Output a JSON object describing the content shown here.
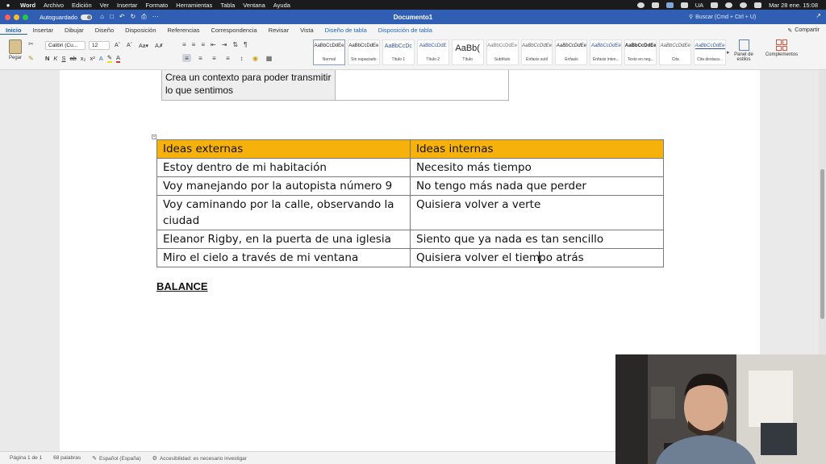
{
  "menubar": {
    "app": "Word",
    "items": [
      "Archivo",
      "Edición",
      "Ver",
      "Insertar",
      "Formato",
      "Herramientas",
      "Tabla",
      "Ventana",
      "Ayuda"
    ],
    "keyboard": "UA",
    "clock": "Mar 28 ene.  15:08"
  },
  "titlebar": {
    "autosave_label": "Autoguardado",
    "document_title": "Documento1",
    "search_placeholder": "Buscar (Cmd + Ctrl + U)"
  },
  "ribbon_tabs": [
    "Inicio",
    "Insertar",
    "Dibujar",
    "Diseño",
    "Disposición",
    "Referencias",
    "Correspondencia",
    "Revisar",
    "Vista",
    "Diseño de tabla",
    "Disposición de tabla"
  ],
  "share_label": "Compartir",
  "ribbon": {
    "paste_label": "Pegar",
    "font_name": "Calibri (Cu...",
    "font_size": "12",
    "styles": [
      {
        "preview": "AaBbCcDdEe",
        "name": "Normal"
      },
      {
        "preview": "AaBbCcDdEe",
        "name": "Sin espaciado"
      },
      {
        "preview": "AaBbCcDc",
        "name": "Título 1"
      },
      {
        "preview": "AaBbCcDdE",
        "name": "Título 2"
      },
      {
        "preview": "AaBb(",
        "name": "Título"
      },
      {
        "preview": "AaBbCcDdEe",
        "name": "Subtítulo"
      },
      {
        "preview": "AaBbCcDdEe",
        "name": "Énfasis sutil"
      },
      {
        "preview": "AaBbCcDdEe",
        "name": "Énfasis"
      },
      {
        "preview": "AaBbCcDdEe",
        "name": "Énfasis inten..."
      },
      {
        "preview": "AaBbCcDdEe",
        "name": "Texto en neg..."
      },
      {
        "preview": "AaBbCcDdEe",
        "name": "Cita"
      },
      {
        "preview": "AaBbCcDdEe",
        "name": "Cita destaca..."
      }
    ],
    "styles_pane_label": "Panel de estilos",
    "addins_label": "Complementos"
  },
  "document": {
    "previous_table_text": "Crea un contexto para poder transmitir lo que sentimos",
    "table": {
      "headers": [
        "Ideas externas",
        "Ideas internas"
      ],
      "rows": [
        [
          "Estoy dentro de mi habitación",
          "Necesito más tiempo"
        ],
        [
          "Voy manejando por la autopista número 9",
          "No tengo más nada que perder"
        ],
        [
          "Voy caminando por la calle, observando la ciudad",
          "Quisiera volver a verte"
        ],
        [
          "Eleanor Rigby, en la puerta de una iglesia",
          "Siento que ya nada es tan sencillo"
        ],
        [
          "Miro el cielo a través de mi ventana",
          "Quisiera volver el tiempo atrás"
        ]
      ]
    },
    "heading": "BALANCE"
  },
  "statusbar": {
    "page": "Página 1 de 1",
    "words": "68 palabras",
    "language": "Español (España)",
    "accessibility": "Accesibilidad: es necesario investigar"
  },
  "colors": {
    "menubar": "#1b1b1c",
    "titlebar": "#2f5eb3",
    "ribbon": "#f4f4f4",
    "table_header": "#f6b10a",
    "accent": "#1e5ea8"
  }
}
